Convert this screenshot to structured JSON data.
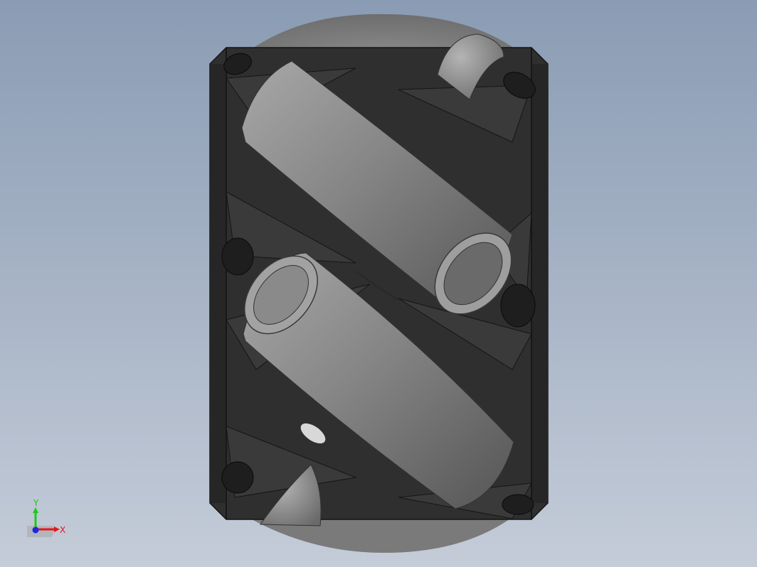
{
  "viewport": {
    "model": "mecanum-wheel",
    "colors": {
      "background_top": "#8a9cb4",
      "background_bottom": "#c4ccd8",
      "frame": "#2e2e2e",
      "frame_edge": "#141414",
      "roller_light": "#9a9a9a",
      "roller_dark": "#4e4e4e"
    }
  },
  "triad": {
    "x_label": "X",
    "y_label": "Y",
    "x_color": "#e8141e",
    "y_color": "#1ec81e",
    "z_color": "#1e28dc"
  }
}
